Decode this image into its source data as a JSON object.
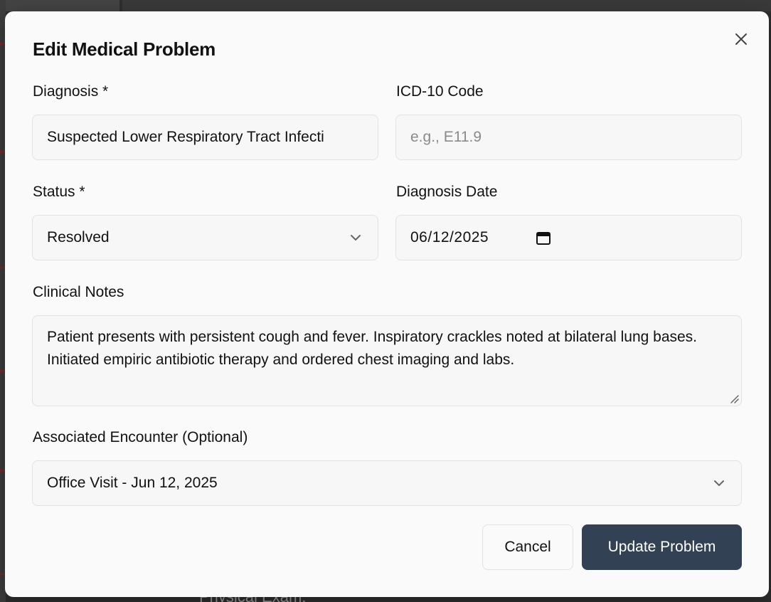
{
  "background": {
    "partial_text": "Physical Exam:"
  },
  "modal": {
    "title": "Edit Medical Problem",
    "close_icon": "close-icon",
    "diagnosis": {
      "label": "Diagnosis *",
      "value": "Suspected Lower Respiratory Tract Infecti"
    },
    "icd10": {
      "label": "ICD-10 Code",
      "placeholder": "e.g., E11.9",
      "value": ""
    },
    "status": {
      "label": "Status *",
      "selected": "Resolved"
    },
    "diagnosis_date": {
      "label": "Diagnosis Date",
      "value": "06/12/2025"
    },
    "clinical_notes": {
      "label": "Clinical Notes",
      "value": "Patient presents with persistent cough and fever. Inspiratory crackles noted at bilateral lung bases. Initiated empiric antibiotic therapy and ordered chest imaging and labs."
    },
    "encounter": {
      "label": "Associated Encounter (Optional)",
      "selected": "Office Visit - Jun 12, 2025"
    },
    "buttons": {
      "cancel": "Cancel",
      "update": "Update Problem"
    }
  },
  "colors": {
    "primary_button": "#334155",
    "modal_bg": "#fafafa",
    "field_border": "#e2e2e2"
  }
}
